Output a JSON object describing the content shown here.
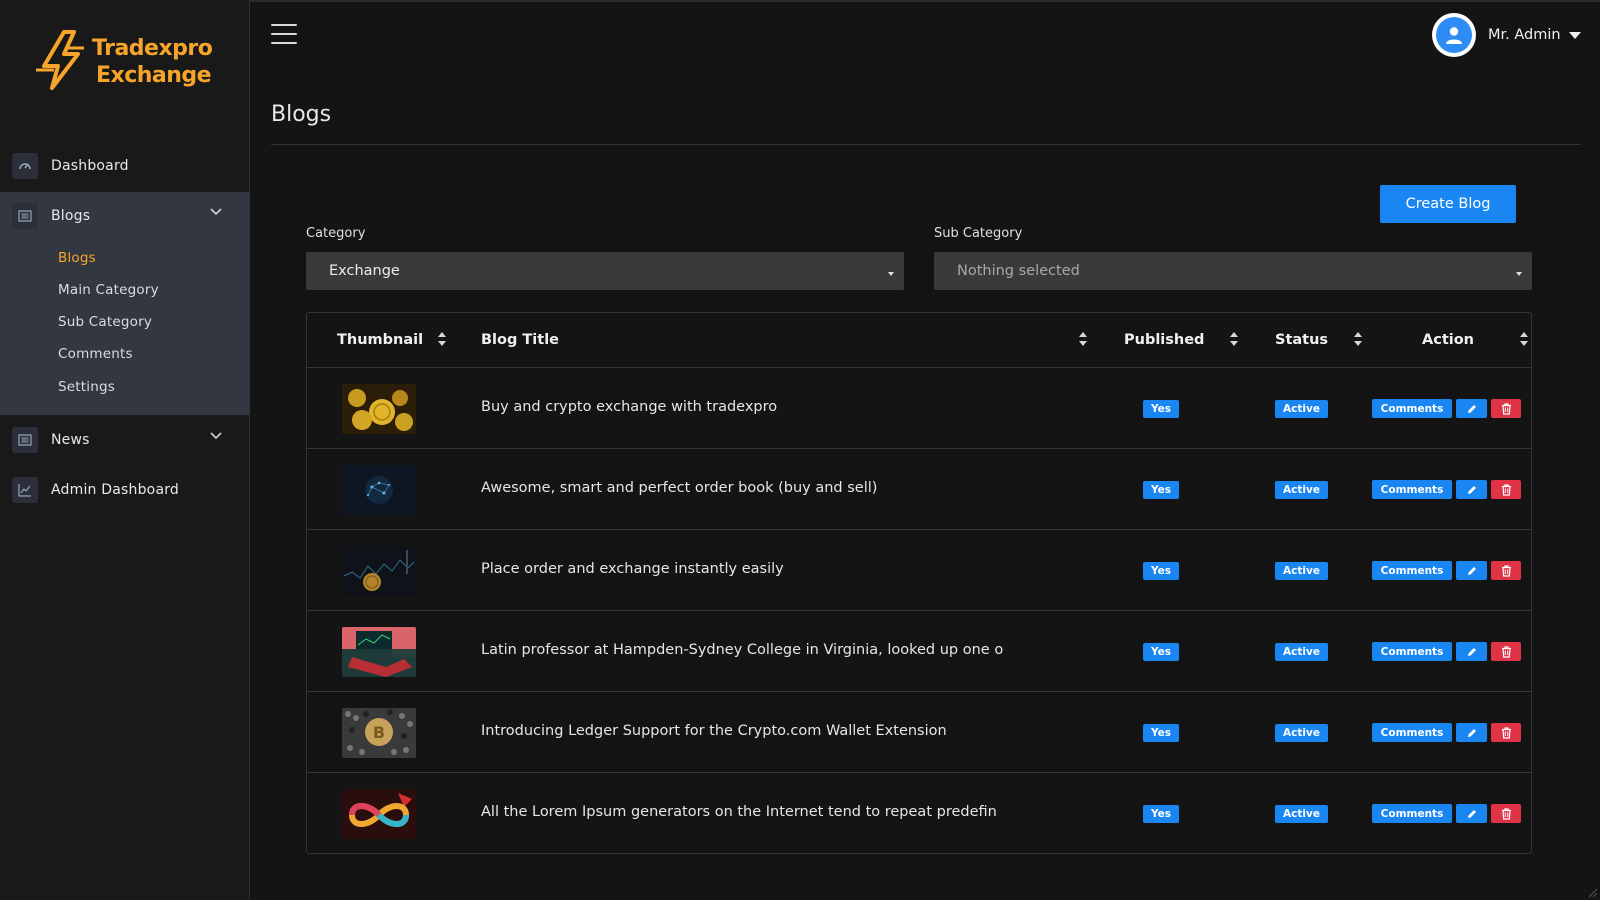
{
  "brand": {
    "line1": "Tradexpro",
    "line2": "Exchange",
    "accent": "#f7a52a"
  },
  "sidebar": {
    "items": [
      {
        "label": "Dashboard",
        "icon": "speedometer-icon"
      },
      {
        "label": "Blogs",
        "icon": "list-icon",
        "expanded": true
      },
      {
        "label": "News",
        "icon": "list-icon"
      },
      {
        "label": "Admin Dashboard",
        "icon": "chart-line-icon"
      }
    ],
    "blogs_sub": [
      "Blogs",
      "Main Category",
      "Sub Category",
      "Comments",
      "Settings"
    ]
  },
  "topbar": {
    "user_name": "Mr. Admin"
  },
  "page": {
    "title": "Blogs",
    "create_label": "Create Blog"
  },
  "filters": {
    "category_label": "Category",
    "category_value": "Exchange",
    "subcategory_label": "Sub Category",
    "subcategory_value": "Nothing selected"
  },
  "table": {
    "headers": [
      "Thumbnail",
      "Blog Title",
      "Published",
      "Status",
      "Action"
    ],
    "comments_label": "Comments",
    "rows": [
      {
        "title": "Buy and crypto exchange with tradexpro",
        "published": "Yes",
        "status": "Active",
        "thumb": "gold-coins"
      },
      {
        "title": "Awesome, smart and perfect order book (buy and sell)",
        "published": "Yes",
        "status": "Active",
        "thumb": "network"
      },
      {
        "title": "Place order and exchange instantly easily",
        "published": "Yes",
        "status": "Active",
        "thumb": "chart-coin"
      },
      {
        "title": "Latin professor at Hampden-Sydney College in Virginia, looked up one o",
        "published": "Yes",
        "status": "Active",
        "thumb": "desk"
      },
      {
        "title": "Introducing Ledger Support for the Crypto.com Wallet Extension",
        "published": "Yes",
        "status": "Active",
        "thumb": "bitcoin"
      },
      {
        "title": "All the Lorem Ipsum generators on the Internet tend to repeat predefin",
        "published": "Yes",
        "status": "Active",
        "thumb": "infinity"
      }
    ]
  },
  "colors": {
    "primary": "#1a86f2",
    "danger": "#e03446",
    "bg": "#141414",
    "sidebar_active": "#333741"
  }
}
